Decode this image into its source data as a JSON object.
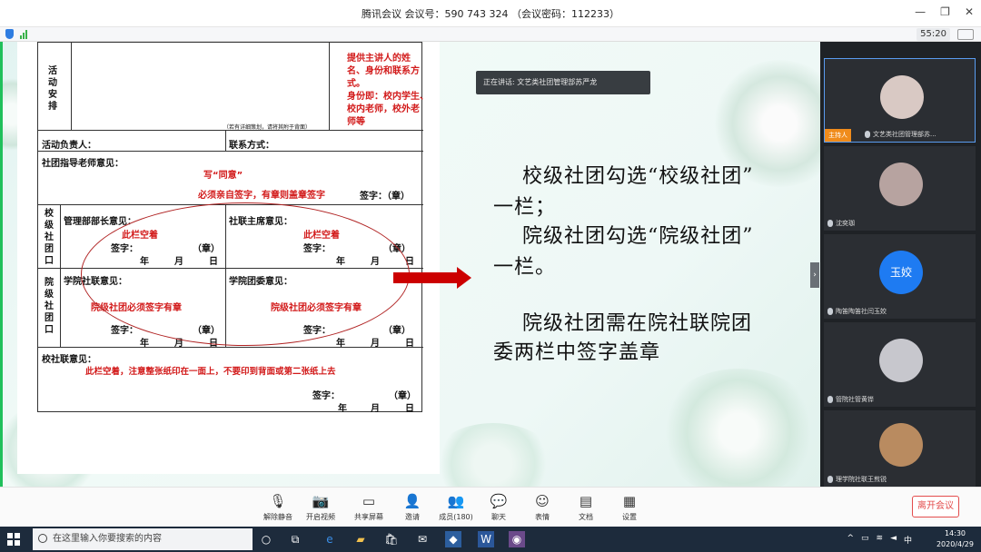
{
  "window": {
    "title": "腾讯会议 会议号：590 743 324 （会议密码：112233）",
    "timer": "55:20"
  },
  "speaking": "正在讲话: 文艺类社团管理部苏严龙",
  "form": {
    "activity_label": "活动安排",
    "activity_note": "（若有详细策划，请将其附于背面）",
    "right_notes": [
      "提供主讲人的姓",
      "名、身份和联系方",
      "式。",
      "身份即：校内学生、",
      "校内老师，校外老",
      "师等"
    ],
    "leader_label": "活动负责人：",
    "contact_label": "联系方式：",
    "advisor_label": "社团指导老师意见：",
    "advisor_note1": "写“同意”",
    "advisor_note2": "必须亲自签字，有章则盖章签字",
    "sign_seal": "签字：（章）",
    "sign_label": "签字：",
    "seal_label": "（章）",
    "school_level": "校级社团口",
    "college_level": "院级社团口",
    "dept_head_label": "管理部部长意见：",
    "union_chair_label": "社联主席意见：",
    "blank_note": "此栏空着",
    "college_union_label": "学院社联意见：",
    "league_label": "学院团委意见：",
    "college_must_note": "院级社团必须签字有章",
    "college_union_opinion_label": "校社联意见：",
    "bottom_note": "此栏空着，注意整张纸印在一面上，不要印到背面或第二张纸上去",
    "year": "年",
    "month": "月",
    "day": "日"
  },
  "slide": {
    "lines": [
      "校级社团勾选“校级社团”",
      "一栏；",
      "院级社团勾选“院级社团”",
      "一栏。",
      "院级社团需在院社联院团",
      "委两栏中签字盖章"
    ]
  },
  "participants": [
    {
      "name": "文艺类社团管理部苏...",
      "host_badge": "主持人",
      "avatar_color": "#d9c9c4"
    },
    {
      "name": "沈奕珈",
      "avatar_color": "#b7a3a0"
    },
    {
      "name": "陶笛陶笛社闫玉姣",
      "avatar_text": "玉姣",
      "avatar_color": "#1e7bf2"
    },
    {
      "name": "管院社管黄铧",
      "avatar_color": "#c7c7cd"
    },
    {
      "name": "理学院社联王煎锐",
      "avatar_color": "#b98b60"
    }
  ],
  "toolbar": {
    "mute": "解除静音",
    "video": "开启视频",
    "share": "共享屏幕",
    "invite": "邀请",
    "members": "成员(180)",
    "chat": "聊天",
    "reaction": "表情",
    "docs": "文档",
    "settings": "设置",
    "leave": "离开会议"
  },
  "taskbar": {
    "search_placeholder": "在这里输入你要搜索的内容",
    "time": "14:30",
    "date": "2020/4/29",
    "ime": "中"
  }
}
